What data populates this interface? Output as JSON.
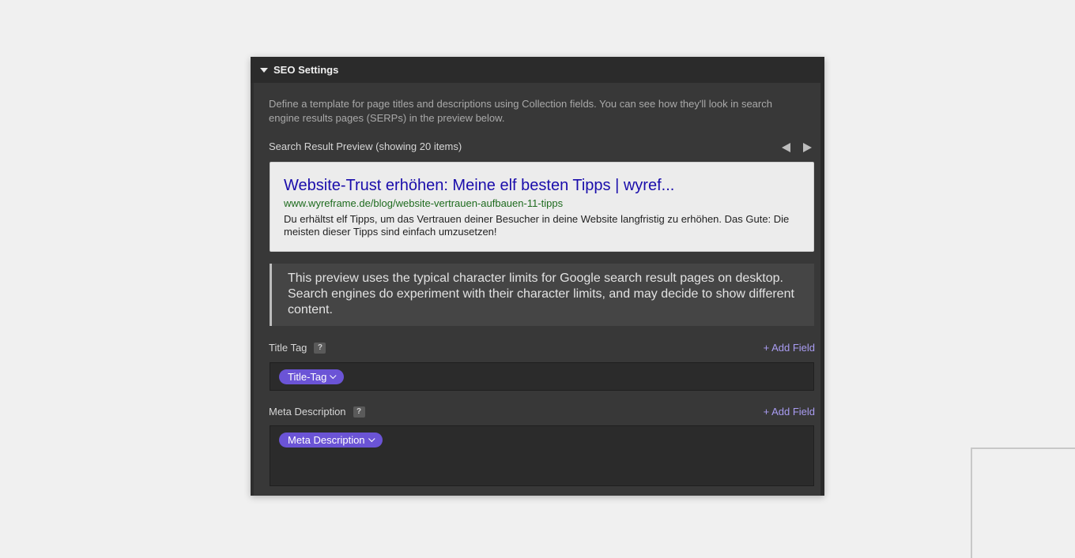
{
  "panel": {
    "title": "SEO Settings",
    "intro": "Define a template for page titles and descriptions using Collection fields. You can see how they'll look in search engine results pages (SERPs) in the preview below."
  },
  "preview": {
    "label": "Search Result Preview (showing 20 items)",
    "serp": {
      "title": "Website-Trust erhöhen: Meine elf besten Tipps | wyref...",
      "url": "www.wyreframe.de/blog/website-vertrauen-aufbauen-11-tipps",
      "description": "Du erhältst elf Tipps, um das Vertrauen deiner Besucher in deine Website langfristig zu erhöhen. Das Gute: Die meisten dieser Tipps sind einfach umzusetzen!"
    },
    "notice": "This preview uses the typical character limits for Google search result pages on desktop. Search engines do experiment with their character limits, and may decide to show different content."
  },
  "fields": {
    "title_tag": {
      "label": "Title Tag",
      "help": "?",
      "add_label": "+ Add Field",
      "pill": "Title-Tag"
    },
    "meta_description": {
      "label": "Meta Description",
      "help": "?",
      "add_label": "+ Add Field",
      "pill": "Meta Description"
    }
  },
  "colors": {
    "panel_bg": "#383838",
    "header_bg": "#2b2b2b",
    "accent_purple": "#6b54d6",
    "link_purple": "#a99cf2",
    "serp_title": "#1a0dab",
    "serp_url": "#1e6b1e"
  },
  "icons": {
    "collapse": "caret-down-icon",
    "prev": "arrow-left-icon",
    "next": "arrow-right-icon",
    "help": "question-mark-icon",
    "pill_dropdown": "chevron-down-icon"
  }
}
